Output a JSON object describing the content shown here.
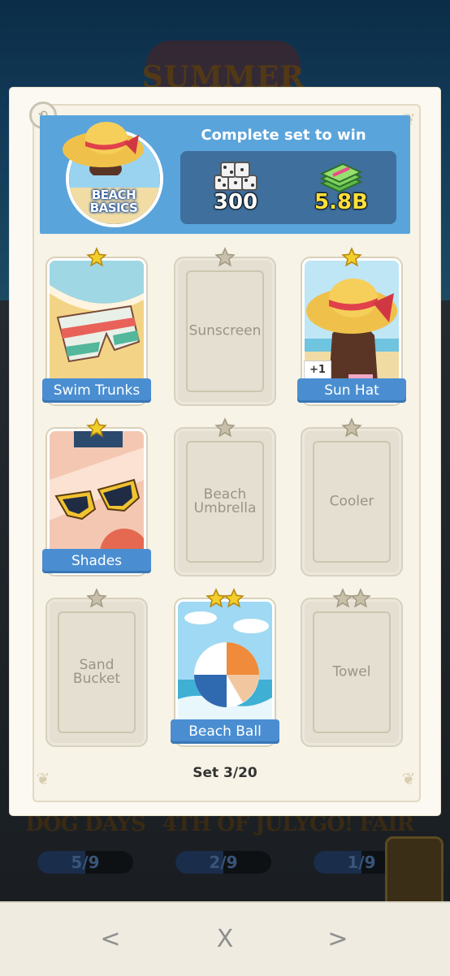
{
  "background": {
    "event_title": "SUMMER",
    "sets": [
      {
        "name": "DOG DAYS",
        "progress": "5/9"
      },
      {
        "name": "4TH OF JULY",
        "progress": "2/9"
      },
      {
        "name": "GO! FAIR",
        "progress": "1/9"
      }
    ]
  },
  "header": {
    "set_name": "BEACH BASICS",
    "reward_title": "Complete set to win",
    "dice_reward": "300",
    "cash_reward": "5.8B",
    "icons": {
      "dice": "dice-stack-icon",
      "cash": "cash-stack-icon",
      "history": "history-icon"
    }
  },
  "cards": [
    {
      "name": "Swim Trunks",
      "stars": 1,
      "collected": true
    },
    {
      "name": "Sunscreen",
      "stars": 1,
      "collected": false
    },
    {
      "name": "Sun Hat",
      "stars": 1,
      "collected": true,
      "duplicates": "+1"
    },
    {
      "name": "Shades",
      "stars": 1,
      "collected": true
    },
    {
      "name": "Beach\nUmbrella",
      "stars": 1,
      "collected": false
    },
    {
      "name": "Cooler",
      "stars": 1,
      "collected": false
    },
    {
      "name": "Sand\nBucket",
      "stars": 1,
      "collected": false
    },
    {
      "name": "Beach Ball",
      "stars": 2,
      "collected": true
    },
    {
      "name": "Towel",
      "stars": 2,
      "collected": false
    }
  ],
  "footer": {
    "set_counter": "Set 3/20"
  },
  "nav": {
    "prev": "<",
    "close": "X",
    "next": ">"
  },
  "colors": {
    "banner": "#4a8ed1",
    "header": "#5aa4dc",
    "star_gold": "#f3cf2c",
    "star_grey": "#c8c0aa"
  }
}
